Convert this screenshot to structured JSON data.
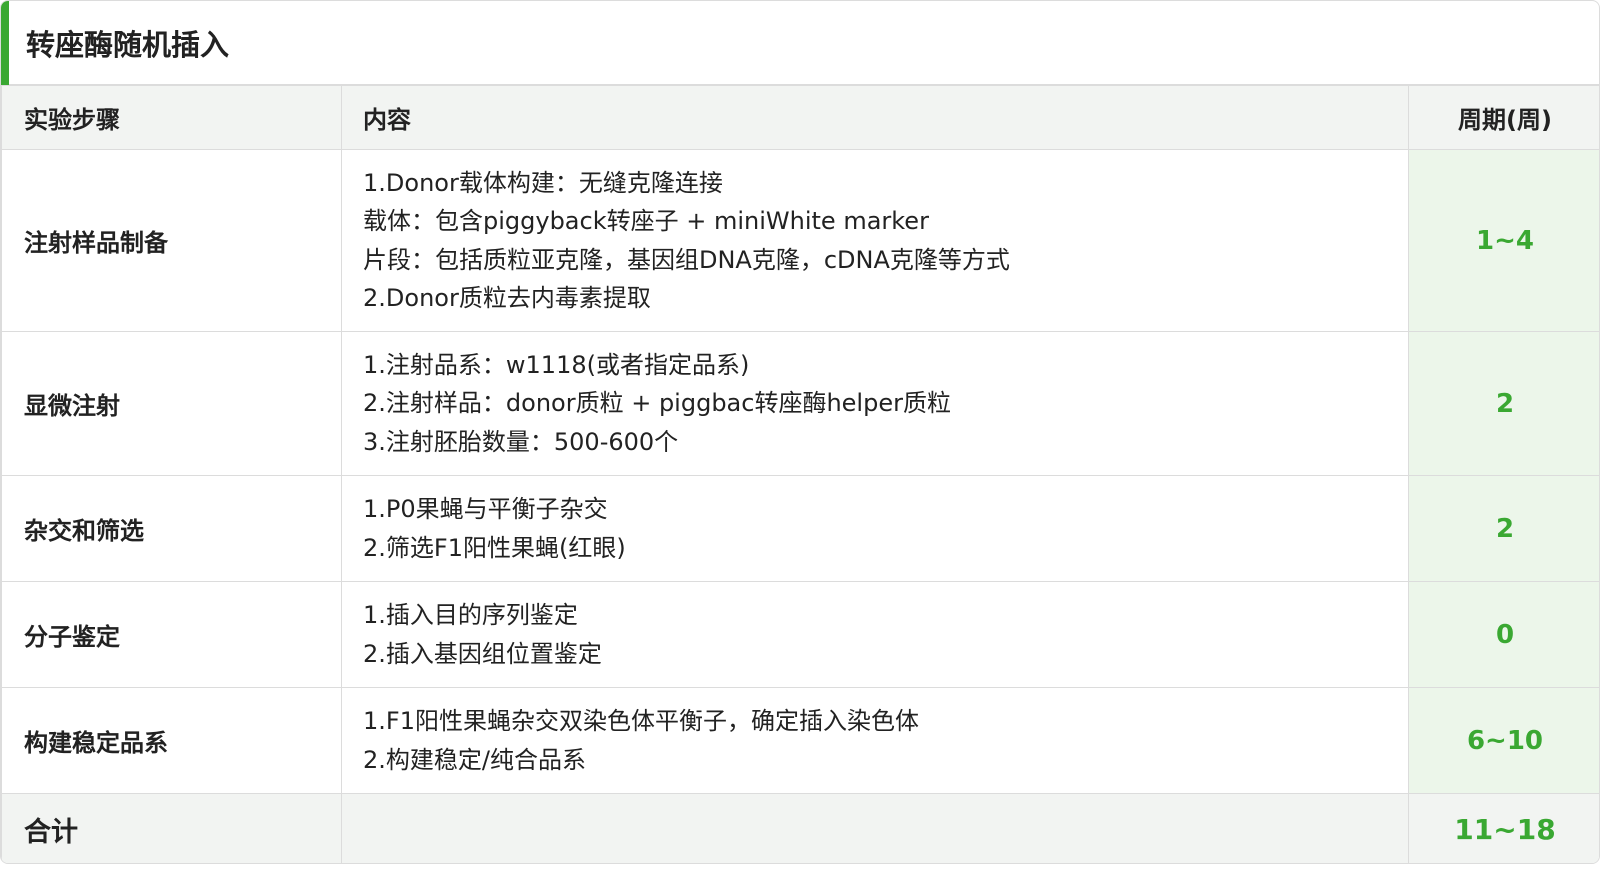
{
  "title": "转座酶随机插入",
  "headers": {
    "step": "实验步骤",
    "content": "内容",
    "period": "周期(周)"
  },
  "rows": [
    {
      "step": "注射样品制备",
      "lines": [
        "1.Donor载体构建：无缝克隆连接",
        "载体：包含piggyback转座子 + miniWhite marker",
        "片段：包括质粒亚克隆，基因组DNA克隆，cDNA克隆等方式",
        "2.Donor质粒去内毒素提取"
      ],
      "period": "1~4"
    },
    {
      "step": "显微注射",
      "lines": [
        "1.注射品系：w1118(或者指定品系)",
        "2.注射样品：donor质粒 + piggbac转座酶helper质粒",
        "3.注射胚胎数量：500-600个"
      ],
      "period": "2"
    },
    {
      "step": "杂交和筛选",
      "lines": [
        "1.P0果蝇与平衡子杂交",
        "2.筛选F1阳性果蝇(红眼)"
      ],
      "period": "2"
    },
    {
      "step": "分子鉴定",
      "lines": [
        "1.插入目的序列鉴定",
        "2.插入基因组位置鉴定"
      ],
      "period": "0"
    },
    {
      "step": "构建稳定品系",
      "lines": [
        "1.F1阳性果蝇杂交双染色体平衡子，确定插入染色体",
        "2.构建稳定/纯合品系"
      ],
      "period": "6~10"
    }
  ],
  "total": {
    "label": "合计",
    "content": "",
    "period": "11~18"
  },
  "colors": {
    "accent": "#3aa832",
    "period_bg": "#ecf6ea",
    "header_bg": "#f2f4f2",
    "border": "#dcdcdc"
  }
}
